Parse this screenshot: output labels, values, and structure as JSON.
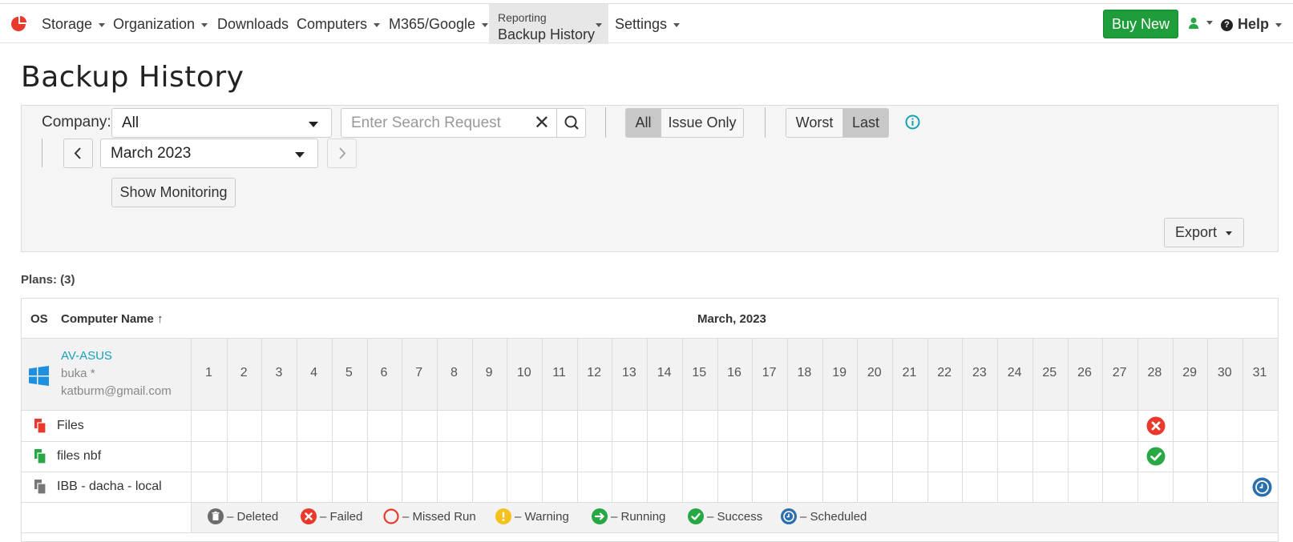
{
  "nav": {
    "items": [
      {
        "label": "Storage"
      },
      {
        "label": "Organization"
      },
      {
        "label": "Downloads"
      },
      {
        "label": "Computers"
      },
      {
        "label": "M365/Google"
      }
    ],
    "active_sub": "Reporting",
    "active_main": "Backup History",
    "settings": "Settings",
    "buy_new": "Buy New",
    "help": "Help"
  },
  "page_title": "Backup History",
  "filters": {
    "company_label": "Company:",
    "company_value": "All",
    "search_placeholder": "Enter Search Request",
    "toggle_all": "All",
    "toggle_issue": "Issue Only",
    "toggle_worst": "Worst",
    "toggle_last": "Last",
    "month_value": "March 2023",
    "show_monitoring": "Show Monitoring",
    "export": "Export"
  },
  "plans_count": "Plans: (3)",
  "table": {
    "col_os": "OS",
    "col_name": "Computer Name ↑",
    "month_header": "March, 2023",
    "days": [
      "1",
      "2",
      "3",
      "4",
      "5",
      "6",
      "7",
      "8",
      "9",
      "10",
      "11",
      "12",
      "13",
      "14",
      "15",
      "16",
      "17",
      "18",
      "19",
      "20",
      "21",
      "22",
      "23",
      "24",
      "25",
      "26",
      "27",
      "28",
      "29",
      "30",
      "31"
    ],
    "computer": {
      "os_icon": "windows-icon",
      "name": "AV-ASUS",
      "user": "buka *",
      "email": "katburm@gmail.com"
    },
    "plans": [
      {
        "name": "Files",
        "icon": "files-plan-icon-red",
        "color": "#e8392c",
        "status": {
          "day": 28,
          "type": "failed"
        }
      },
      {
        "name": "files nbf",
        "icon": "files-plan-icon-green",
        "color": "#28a745",
        "status": {
          "day": 28,
          "type": "success"
        }
      },
      {
        "name": "IBB - dacha - local",
        "icon": "image-plan-icon-gray",
        "color": "#777777",
        "status": {
          "day": 31,
          "type": "scheduled"
        }
      }
    ]
  },
  "legend": [
    {
      "key": "deleted",
      "label": "– Deleted",
      "color": "#6c6c6c"
    },
    {
      "key": "failed",
      "label": "– Failed",
      "color": "#e8392c"
    },
    {
      "key": "missed",
      "label": "– Missed Run",
      "color": "#e8392c"
    },
    {
      "key": "warning",
      "label": "– Warning",
      "color": "#f4c21e"
    },
    {
      "key": "running",
      "label": "– Running",
      "color": "#28a745"
    },
    {
      "key": "success",
      "label": "– Success",
      "color": "#28a745"
    },
    {
      "key": "scheduled",
      "label": "– Scheduled",
      "color": "#2c6fad"
    }
  ]
}
